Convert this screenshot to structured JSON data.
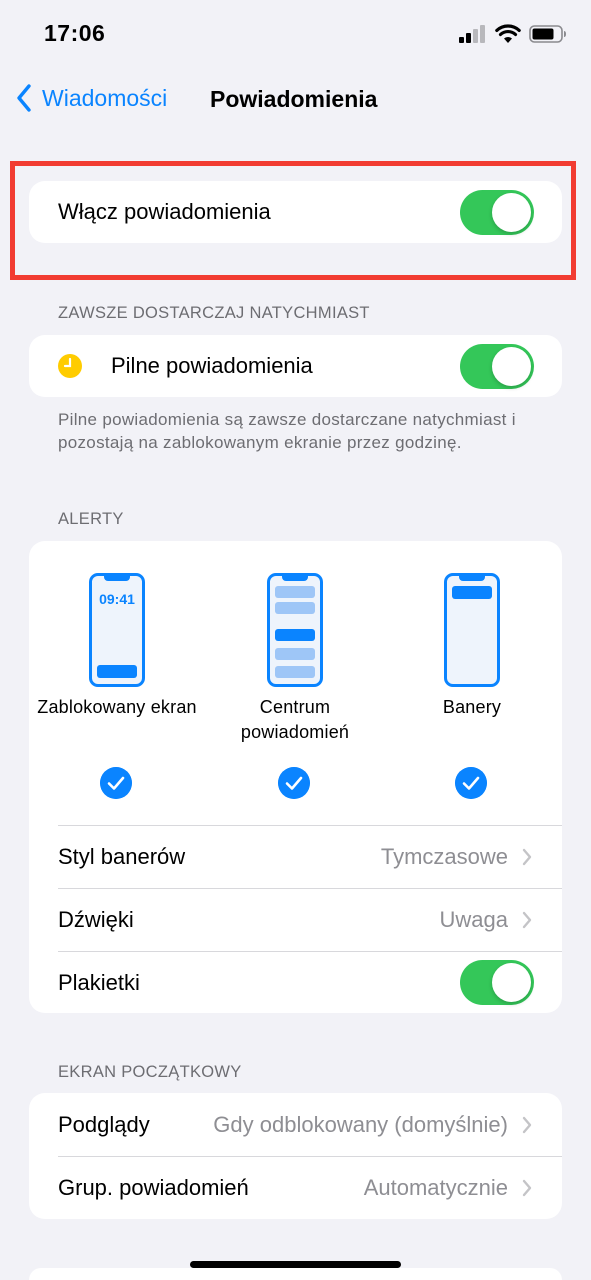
{
  "status": {
    "time": "17:06"
  },
  "nav": {
    "back_label": "Wiadomości",
    "title": "Powiadomienia"
  },
  "main_toggle": {
    "label": "Włącz powiadomienia",
    "on": true
  },
  "immediate": {
    "header": "ZAWSZE DOSTARCZAJ NATYCHMIAST",
    "label": "Pilne powiadomienia",
    "on": true,
    "footnote": "Pilne powiadomienia są zawsze dostarczane natychmiast i pozostają na zablokowanym ekranie przez godzinę."
  },
  "alerts": {
    "header": "ALERTY",
    "lock_time": "09:41",
    "options": [
      {
        "label": "Zablokowany ekran",
        "checked": true
      },
      {
        "label": "Centrum powiadomień",
        "checked": true
      },
      {
        "label": "Banery",
        "checked": true
      }
    ],
    "banner_style": {
      "label": "Styl banerów",
      "value": "Tymczasowe"
    },
    "sounds": {
      "label": "Dźwięki",
      "value": "Uwaga"
    },
    "badges": {
      "label": "Plakietki",
      "on": true
    }
  },
  "lock_screen": {
    "header": "EKRAN POCZĄTKOWY",
    "previews": {
      "label": "Podglądy",
      "value": "Gdy odblokowany (domyślnie)"
    },
    "grouping": {
      "label": "Grup. powiadomień",
      "value": "Automatycznie"
    }
  },
  "colors": {
    "accent": "#0a84ff",
    "toggle_on": "#34c759",
    "highlight": "#f23c32",
    "clock": "#ffcc00"
  }
}
